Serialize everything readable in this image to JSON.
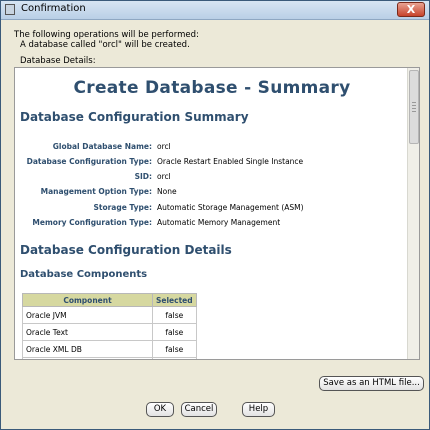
{
  "window": {
    "title": "Confirmation",
    "close_glyph": "X"
  },
  "intro": {
    "line1": "The following operations will be performed:",
    "line2": "A database called \"orcl\" will be created.",
    "details_label": "Database Details:"
  },
  "summary": {
    "title": "Create Database - Summary",
    "config_summary_heading": "Database Configuration Summary",
    "fields": [
      {
        "label": "Global Database Name:",
        "value": "orcl"
      },
      {
        "label": "Database Configuration Type:",
        "value": "Oracle Restart Enabled Single Instance"
      },
      {
        "label": "SID:",
        "value": "orcl"
      },
      {
        "label": "Management Option Type:",
        "value": "None"
      },
      {
        "label": "Storage Type:",
        "value": "Automatic Storage Management (ASM)"
      },
      {
        "label": "Memory Configuration Type:",
        "value": "Automatic Memory Management"
      }
    ],
    "config_details_heading": "Database Configuration Details",
    "components_heading": "Database Components",
    "components_table": {
      "columns": [
        "Component",
        "Selected"
      ],
      "rows": [
        [
          "Oracle JVM",
          "false"
        ],
        [
          "Oracle Text",
          "false"
        ],
        [
          "Oracle XML DB",
          "false"
        ],
        [
          "",
          ""
        ]
      ]
    }
  },
  "buttons": {
    "save_html": "Save as an HTML file...",
    "ok": "OK",
    "cancel": "Cancel",
    "help": "Help"
  }
}
